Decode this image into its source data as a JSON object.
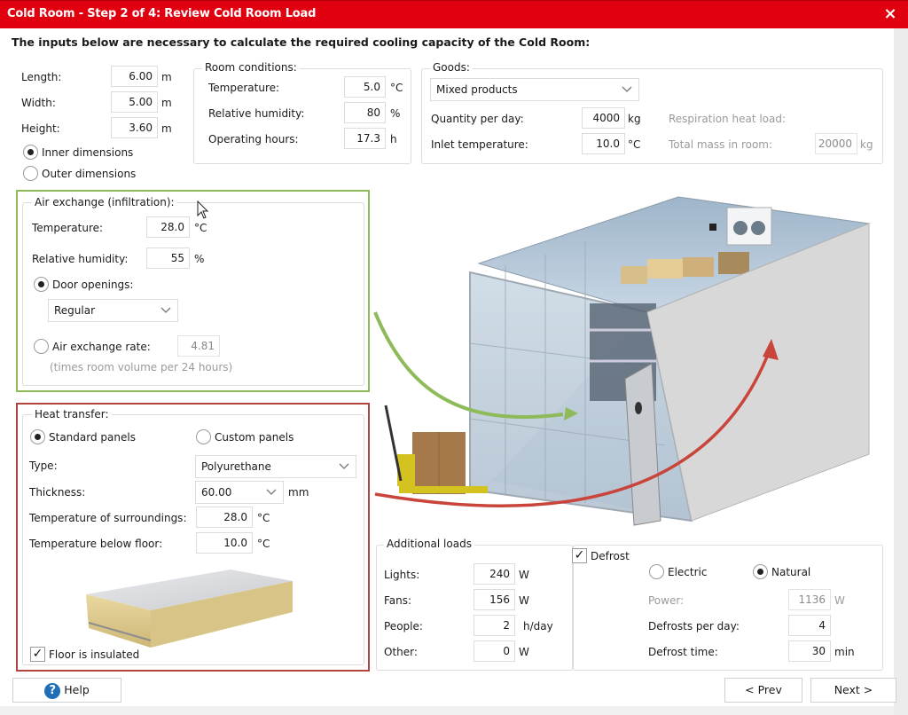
{
  "window": {
    "title": "Cold Room - Step 2 of 4: Review Cold Room Load",
    "close_icon": "×",
    "accent_color": "#e0000f"
  },
  "intro": "The inputs below are necessary to calculate the required cooling capacity of the Cold Room:",
  "dimensions": {
    "length": {
      "label": "Length:",
      "value": "6.00",
      "unit": "m"
    },
    "width": {
      "label": "Width:",
      "value": "5.00",
      "unit": "m"
    },
    "height": {
      "label": "Height:",
      "value": "3.60",
      "unit": "m"
    },
    "inner_label": "Inner dimensions",
    "outer_label": "Outer dimensions",
    "selected": "inner"
  },
  "room_conditions": {
    "legend": "Room conditions:",
    "temperature": {
      "label": "Temperature:",
      "value": "5.0",
      "unit": "°C"
    },
    "humidity": {
      "label": "Relative humidity:",
      "value": "80",
      "unit": "%"
    },
    "hours": {
      "label": "Operating hours:",
      "value": "17.3",
      "unit": "h"
    }
  },
  "goods": {
    "legend": "Goods:",
    "product": "Mixed products",
    "quantity": {
      "label": "Quantity per day:",
      "value": "4000",
      "unit": "kg"
    },
    "inlet": {
      "label": "Inlet temperature:",
      "value": "10.0",
      "unit": "°C"
    },
    "respiration_label": "Respiration heat load:",
    "total_mass": {
      "label": "Total mass in room:",
      "value": "20000",
      "unit": "kg"
    }
  },
  "air_exchange": {
    "legend": "Air exchange (infiltration):",
    "temperature": {
      "label": "Temperature:",
      "value": "28.0",
      "unit": "°C"
    },
    "humidity": {
      "label": "Relative humidity:",
      "value": "55",
      "unit": "%"
    },
    "door_label": "Door openings:",
    "door_value": "Regular",
    "rate_label": "Air exchange rate:",
    "rate_value": "4.81",
    "rate_note": "(times room volume per 24 hours)",
    "selected": "door",
    "box_color": "#8fba5a"
  },
  "heat_transfer": {
    "legend": "Heat transfer:",
    "standard_label": "Standard panels",
    "custom_label": "Custom panels",
    "selected": "standard",
    "type": {
      "label": "Type:",
      "value": "Polyurethane"
    },
    "thickness": {
      "label": "Thickness:",
      "value": "60.00",
      "unit": "mm"
    },
    "surroundings": {
      "label": "Temperature of surroundings:",
      "value": "28.0",
      "unit": "°C"
    },
    "below_floor": {
      "label": "Temperature below floor:",
      "value": "10.0",
      "unit": "°C"
    },
    "floor_insulated_label": "Floor is insulated",
    "floor_insulated": true,
    "box_color": "#b2443e"
  },
  "additional_loads": {
    "legend": "Additional loads",
    "lights": {
      "label": "Lights:",
      "value": "240",
      "unit": "W"
    },
    "fans": {
      "label": "Fans:",
      "value": "156",
      "unit": "W"
    },
    "people": {
      "label": "People:",
      "value": "2",
      "unit": "h/day"
    },
    "other": {
      "label": "Other:",
      "value": "0",
      "unit": "W"
    }
  },
  "defrost": {
    "label": "Defrost",
    "checked": true,
    "electric_label": "Electric",
    "natural_label": "Natural",
    "selected": "natural",
    "power": {
      "label": "Power:",
      "value": "1136",
      "unit": "W"
    },
    "per_day": {
      "label": "Defrosts per day:",
      "value": "4"
    },
    "time": {
      "label": "Defrost time:",
      "value": "30",
      "unit": "min"
    }
  },
  "footer": {
    "help_label": "Help",
    "help_icon": "?",
    "prev_label": "< Prev",
    "next_label": "Next >"
  },
  "check_glyph": "✓"
}
